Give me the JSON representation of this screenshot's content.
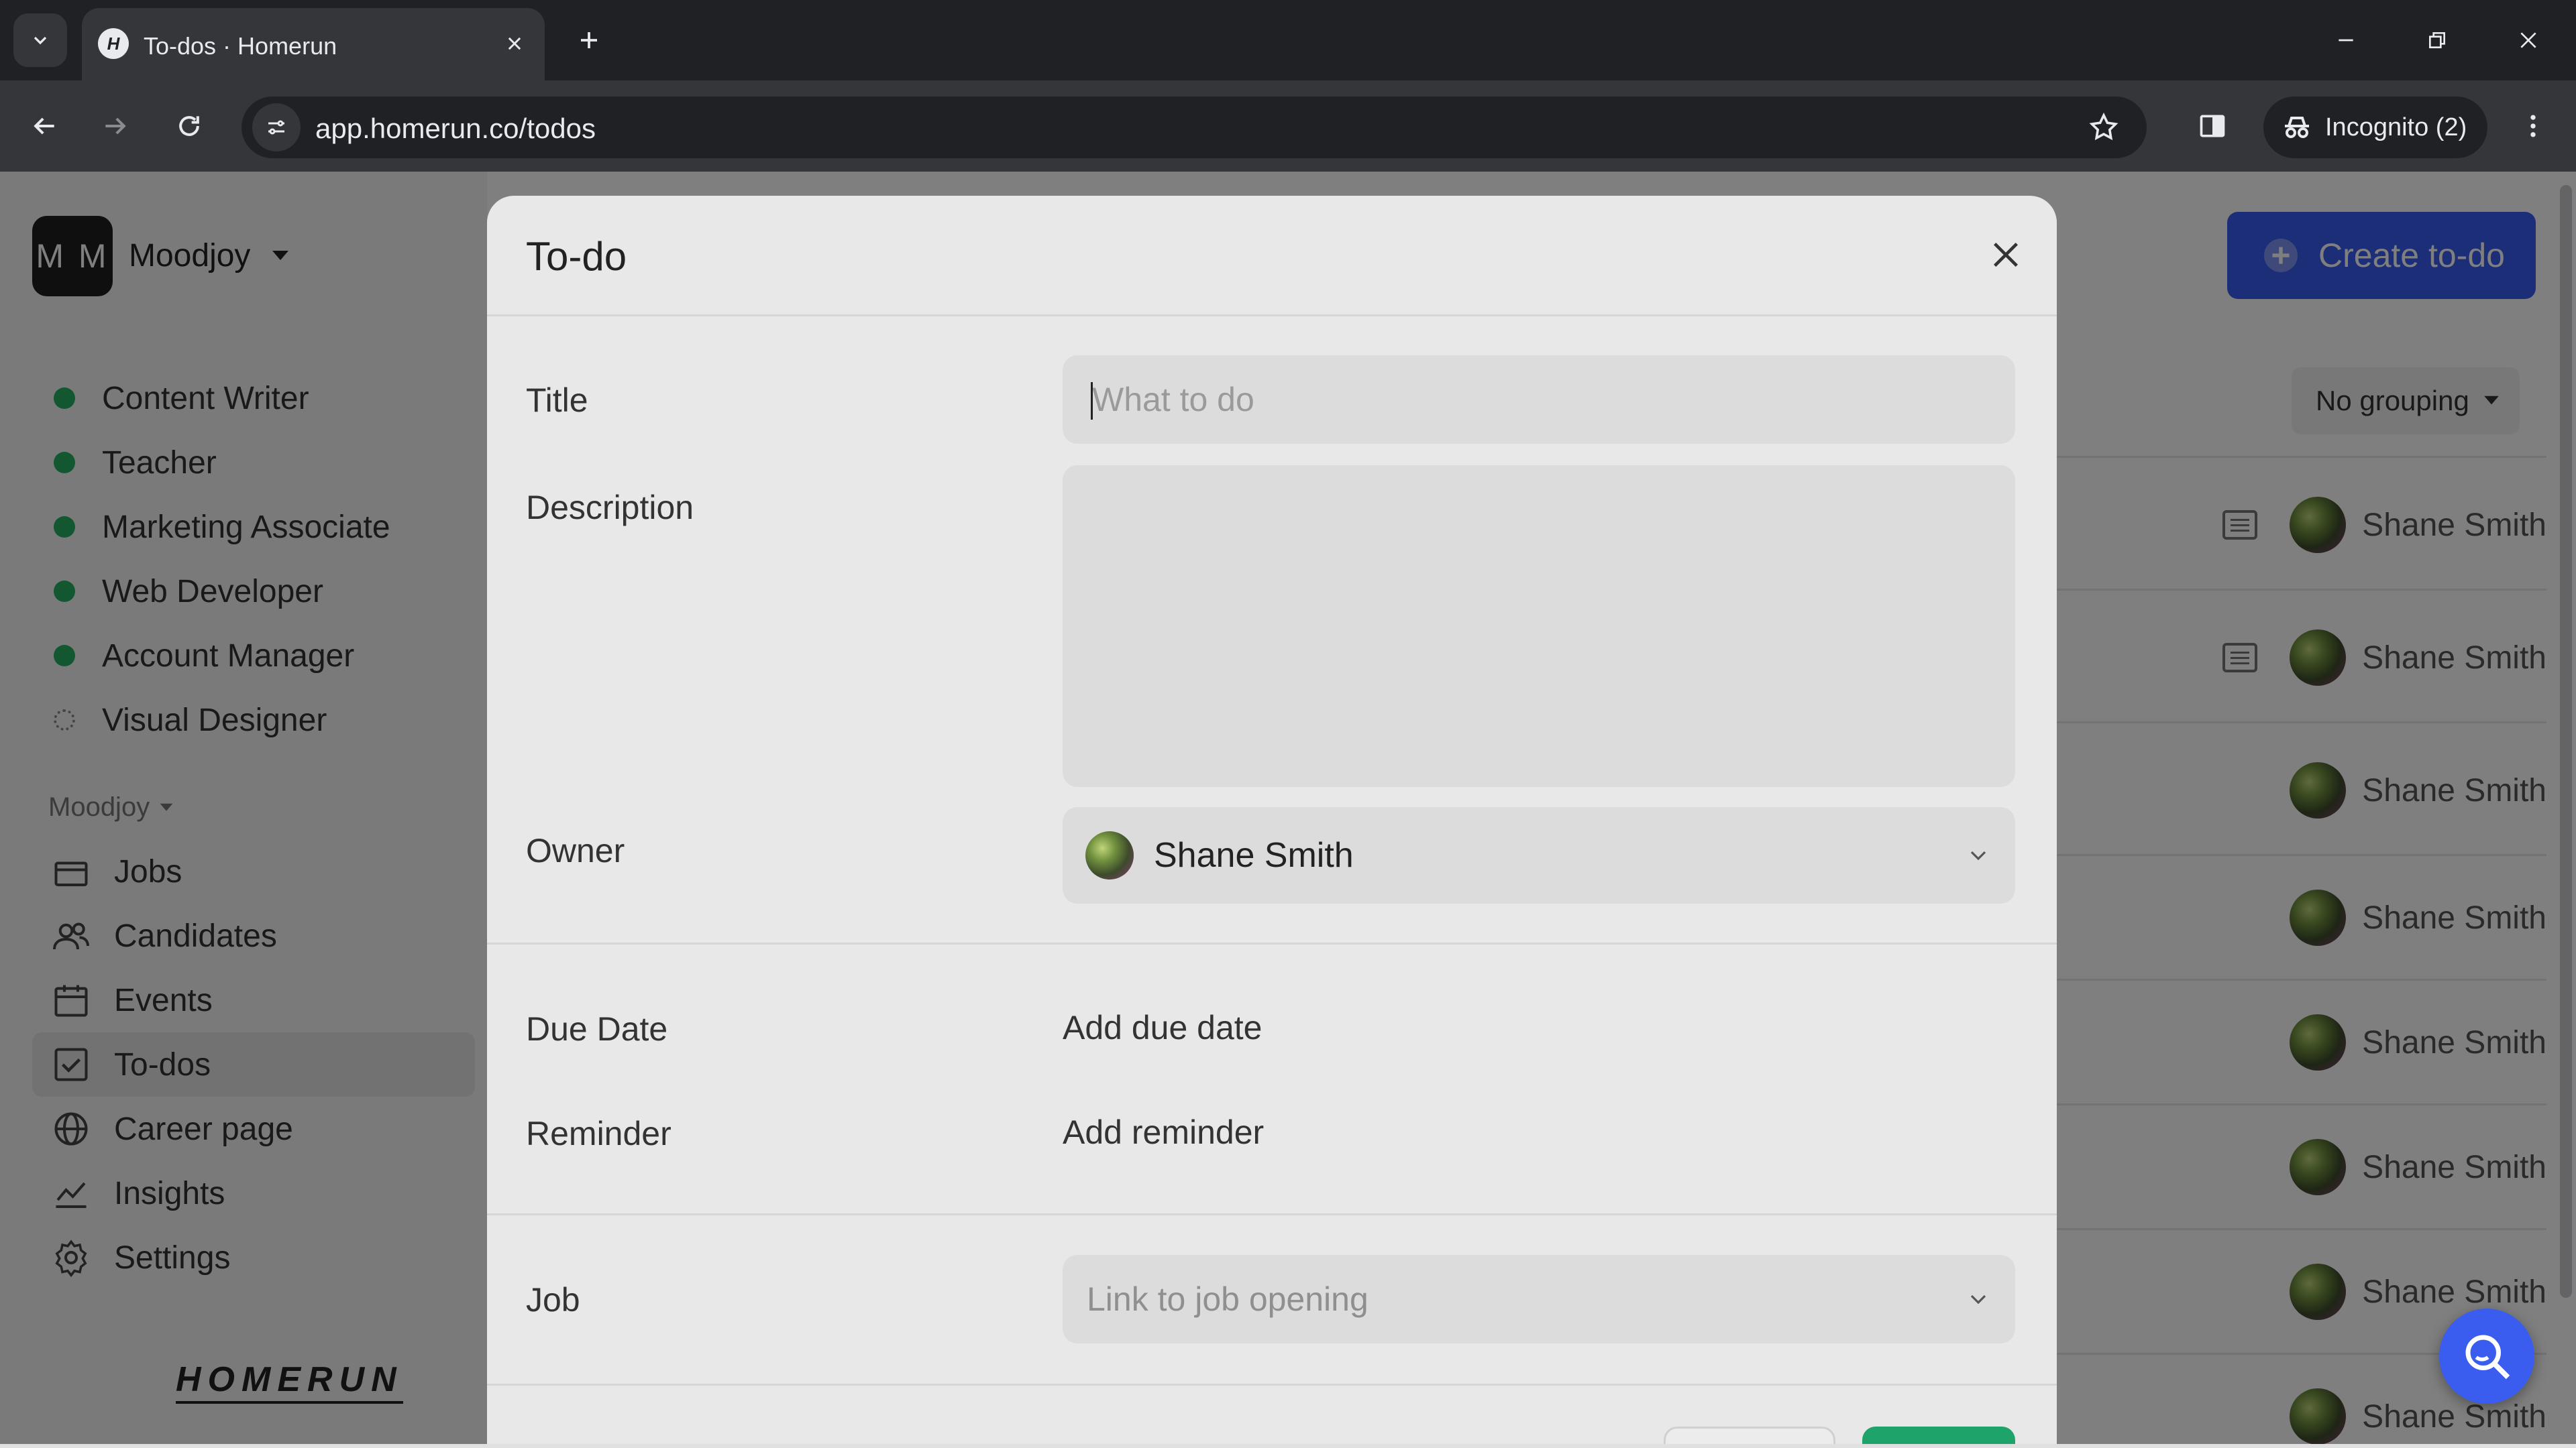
{
  "browser": {
    "tab_title": "To-dos · Homerun",
    "tab_favicon": "H",
    "url": "app.homerun.co/todos",
    "incognito_label": "Incognito (2)"
  },
  "sidebar": {
    "workspace_initials": "M M",
    "workspace_name": "Moodjoy",
    "jobs": [
      {
        "label": "Content Writer",
        "status": "published"
      },
      {
        "label": "Teacher",
        "status": "published"
      },
      {
        "label": "Marketing Associate",
        "status": "published"
      },
      {
        "label": "Web Developer",
        "status": "published"
      },
      {
        "label": "Account Manager",
        "status": "published"
      },
      {
        "label": "Visual Designer",
        "status": "draft"
      }
    ],
    "section_label": "Moodjoy",
    "nav": [
      {
        "label": "Jobs",
        "icon": "briefcase-icon"
      },
      {
        "label": "Candidates",
        "icon": "people-icon"
      },
      {
        "label": "Events",
        "icon": "calendar-icon"
      },
      {
        "label": "To-dos",
        "icon": "checkbox-icon"
      },
      {
        "label": "Career page",
        "icon": "globe-icon"
      },
      {
        "label": "Insights",
        "icon": "chart-line-icon"
      },
      {
        "label": "Settings",
        "icon": "gear-icon"
      }
    ],
    "logo": "HOMERUN"
  },
  "main": {
    "create_button": "Create to-do",
    "grouping": "No grouping",
    "rows": [
      {
        "owner": "Shane Smith",
        "has_note": true
      },
      {
        "owner": "Shane Smith",
        "has_note": true
      },
      {
        "owner": "Shane Smith",
        "has_note": false
      },
      {
        "owner": "Shane Smith",
        "has_note": false
      },
      {
        "owner": "Shane Smith",
        "has_note": false
      },
      {
        "owner": "Shane Smith",
        "has_note": false
      },
      {
        "owner": "Shane Smith",
        "has_note": false
      },
      {
        "owner": "Shane Smith",
        "has_note": false
      }
    ]
  },
  "modal": {
    "title": "To-do",
    "title_label": "Title",
    "title_placeholder": "What to do",
    "description_label": "Description",
    "owner_label": "Owner",
    "owner_value": "Shane Smith",
    "due_date_label": "Due Date",
    "due_date_action": "Add due date",
    "reminder_label": "Reminder",
    "reminder_action": "Add reminder",
    "job_label": "Job",
    "job_placeholder": "Link to job opening"
  },
  "colors": {
    "accent_blue": "#3a5df0",
    "published_green": "#27ae60",
    "save_green": "#1ea36a"
  }
}
